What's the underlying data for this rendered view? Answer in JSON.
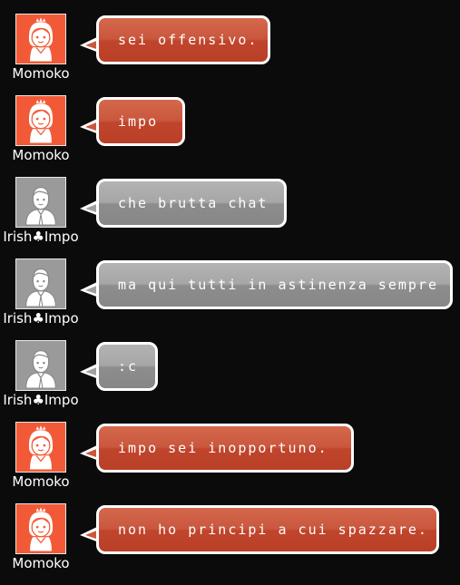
{
  "colors": {
    "background": "#0b0b0b",
    "momoko_bubble": "#c9573d",
    "impo_bubble": "#a0a0a0",
    "momoko_avatar": "#f25a37",
    "impo_avatar": "#9a9a9a"
  },
  "messages": [
    {
      "user": "Momoko",
      "avatar_icon": "girl-avatar-icon",
      "text": "sei offensivo."
    },
    {
      "user": "Momoko",
      "avatar_icon": "girl-avatar-icon",
      "text": "impo"
    },
    {
      "user": "Irish♣Impo",
      "avatar_icon": "boy-avatar-icon",
      "text": "che brutta chat"
    },
    {
      "user": "Irish♣Impo",
      "avatar_icon": "boy-avatar-icon",
      "text": "ma qui tutti in astinenza sempre"
    },
    {
      "user": "Irish♣Impo",
      "avatar_icon": "boy-avatar-icon",
      "text": ":c"
    },
    {
      "user": "Momoko",
      "avatar_icon": "girl-avatar-icon",
      "text": "impo sei inopportuno."
    },
    {
      "user": "Momoko",
      "avatar_icon": "girl-avatar-icon",
      "text": "non ho principi a cui spazzare."
    }
  ]
}
